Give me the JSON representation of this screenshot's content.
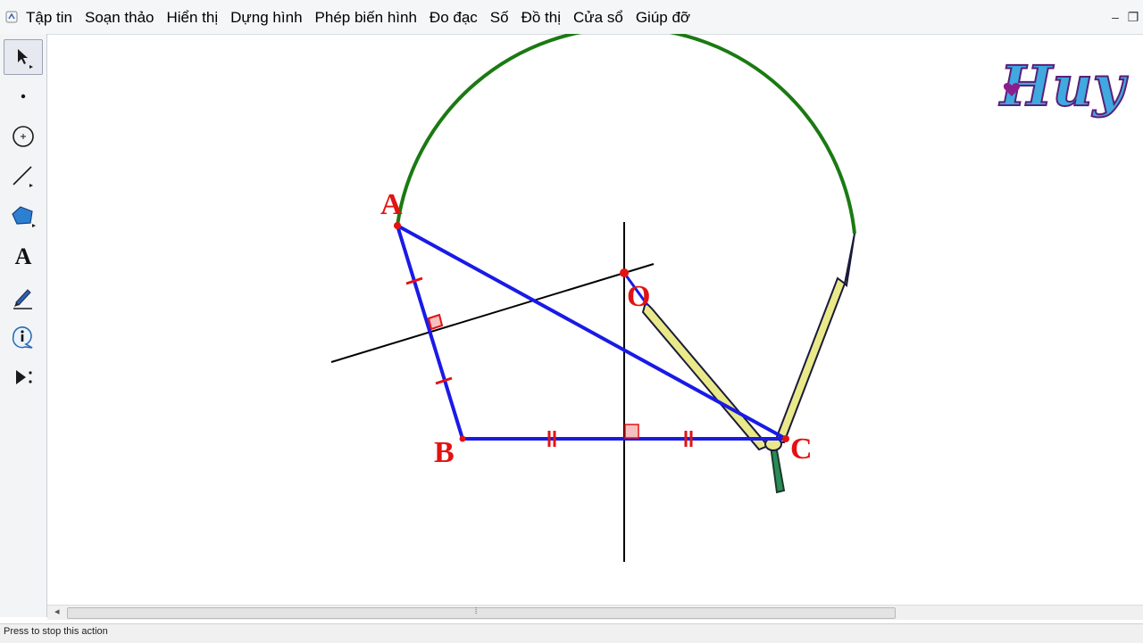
{
  "menubar": {
    "items": [
      "Tập tin",
      "Soạn thảo",
      "Hiển thị",
      "Dựng hình",
      "Phép biến hình",
      "Đo đạc",
      "Số",
      "Đồ thị",
      "Cửa sổ",
      "Giúp đỡ"
    ],
    "minimize_glyph": "–",
    "restore_glyph": "❐"
  },
  "toolbox": {
    "tools": [
      "arrow-select-tool",
      "point-tool",
      "compass-tool",
      "straightedge-tool",
      "polygon-tool",
      "text-tool",
      "marker-tool",
      "information-tool",
      "custom-tool"
    ],
    "text_tool_glyph": "A"
  },
  "sketch": {
    "labels": {
      "A": "A",
      "B": "B",
      "C": "C",
      "O": "O"
    },
    "colors": {
      "triangle": "#1a1ae6",
      "arc": "#1a7a12",
      "labels": "#e31212",
      "construction_lines": "#000000",
      "compass_legs": "#e9e98a",
      "tick_marks": "#e31212"
    }
  },
  "watermark": {
    "text": "Huy"
  },
  "scrollbar": {
    "left_arrow": "◂",
    "grip": "⦙"
  },
  "status": {
    "text": "Press to stop this action"
  }
}
